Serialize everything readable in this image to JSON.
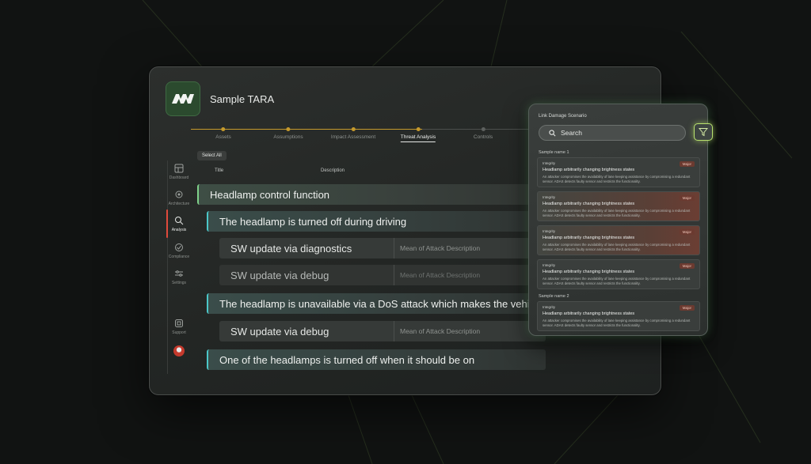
{
  "app": {
    "title": "Sample TARA"
  },
  "stepper": {
    "steps": [
      {
        "label": "Assets",
        "state": "done"
      },
      {
        "label": "Assumptions",
        "state": "done"
      },
      {
        "label": "Impact Assessment",
        "state": "done"
      },
      {
        "label": "Threat Analysis",
        "state": "active"
      },
      {
        "label": "Controls",
        "state": "todo"
      }
    ]
  },
  "toolbar": {
    "select_all_label": "Select All"
  },
  "table": {
    "columns": [
      "Title",
      "Description"
    ],
    "rows": [
      {
        "level": 1,
        "title": "Headlamp control function",
        "description": ""
      },
      {
        "level": 2,
        "title": "The headlamp is turned off during driving",
        "description": ""
      },
      {
        "level": 3,
        "title": "SW update via diagnostics",
        "description": "Mean of Attack Description"
      },
      {
        "level": 3,
        "title": "SW update via debug",
        "description": "Mean of Attack Description"
      },
      {
        "level": 2,
        "title": "The headlamp is unavailable via a DoS attack which makes the vehicle",
        "description": ""
      },
      {
        "level": 3,
        "title": "SW update via debug",
        "description": "Mean of Attack Description"
      },
      {
        "level": 2,
        "title": "One of the headlamps is turned off when it should be on",
        "description": ""
      }
    ]
  },
  "sidebar": {
    "items": [
      {
        "label": "Dashboard",
        "icon": "dashboard-icon"
      },
      {
        "label": "Architecture",
        "icon": "architecture-icon"
      },
      {
        "label": "Analysis",
        "icon": "analysis-icon",
        "active": true
      },
      {
        "label": "Compliance",
        "icon": "compliance-icon"
      },
      {
        "label": "Settings",
        "icon": "settings-icon"
      },
      {
        "label": "Support",
        "icon": "support-icon"
      }
    ]
  },
  "panel": {
    "title": "Link Damage Scenario",
    "search_placeholder": "Search",
    "groups": [
      {
        "label": "Sample name 1",
        "cards": [
          {
            "category": "Integrity",
            "badge": "Major",
            "title": "Headlamp arbitrarily changing brightness states",
            "body": "An attacker compromises the availability of lane keeping assistance by compromising a redundant sensor. ADAS detects faulty sensor and restricts the functionality.",
            "tone": "neutral"
          },
          {
            "category": "Integrity",
            "badge": "Major",
            "title": "Headlamp arbitrarily changing brightness states",
            "body": "An attacker compromises the availability of lane keeping assistance by compromising a redundant sensor. ADAS detects faulty sensor and restricts the functionality.",
            "tone": "warn"
          },
          {
            "category": "Integrity",
            "badge": "Major",
            "title": "Headlamp arbitrarily changing brightness states",
            "body": "An attacker compromises the availability of lane keeping assistance by compromising a redundant sensor. ADAS detects faulty sensor and restricts the functionality.",
            "tone": "warn"
          },
          {
            "category": "Integrity",
            "badge": "Major",
            "title": "Headlamp arbitrarily changing brightness states",
            "body": "An attacker compromises the availability of lane keeping assistance by compromising a redundant sensor. ADAS detects faulty sensor and restricts the functionality.",
            "tone": "neutral"
          }
        ]
      },
      {
        "label": "Sample name 2",
        "cards": [
          {
            "category": "Integrity",
            "badge": "Major",
            "title": "Headlamp arbitrarily changing brightness states",
            "body": "An attacker compromises the availability of lane keeping assistance by compromising a redundant sensor. ADAS detects faulty sensor and restricts the functionality.",
            "tone": "neutral"
          }
        ]
      }
    ]
  },
  "colors": {
    "accent_gold": "#c69a2c",
    "accent_green": "#7fd18a",
    "accent_teal": "#4bc7c8",
    "active_red": "#e04a3c",
    "filter_glow": "#b9e26e"
  }
}
